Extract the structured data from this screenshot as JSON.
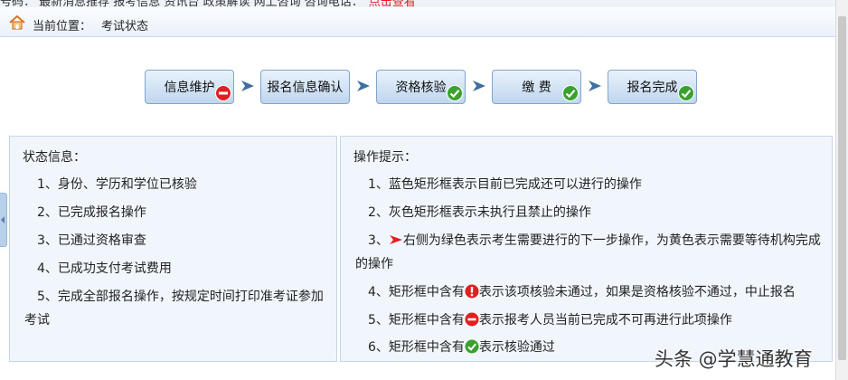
{
  "top_strip": {
    "cut_text": "号码：  最新消息推荐  报考信息  资讯台  政策解读  网上咨询  咨询电话：",
    "cut_red": "点击查看"
  },
  "breadcrumb": {
    "label": "当前位置：",
    "value": "考试状态"
  },
  "steps": [
    {
      "label": "信息维护",
      "status": "blocked",
      "icon": "minus-circle-icon"
    },
    {
      "label": "报名信息确认",
      "status": "none",
      "icon": ""
    },
    {
      "label": "资格核验",
      "status": "passed",
      "icon": "check-circle-icon"
    },
    {
      "label": "缴 费",
      "status": "passed",
      "icon": "check-circle-icon"
    },
    {
      "label": "报名完成",
      "status": "passed",
      "icon": "check-circle-icon"
    }
  ],
  "status_panel": {
    "title": "状态信息：",
    "items": [
      "1、身份、学历和学位已核验",
      "2、已完成报名操作",
      "3、已通过资格审查",
      "4、已成功支付考试费用",
      "5、完成全部报名操作，按规定时间打印准考证参加",
      "考试"
    ]
  },
  "hints_panel": {
    "title": "操作提示：",
    "item1": "1、蓝色矩形框表示目前已完成还可以进行的操作",
    "item2": "2、灰色矩形框表示未执行且禁止的操作",
    "item3_prefix": "3、",
    "item3_text": "右侧为绿色表示考生需要进行的下一步操作，为黄色表示需要等待机构完成",
    "item3_cont": "的操作",
    "item4_prefix": "4、矩形框中含有",
    "item4_text": "表示该项核验未通过，如果是资格核验不通过，中止报名",
    "item5_prefix": "5、矩形框中含有",
    "item5_text": "表示报考人员当前已完成不可再进行此项操作",
    "item6_prefix": "6、矩形框中含有",
    "item6_text": "表示核验通过"
  },
  "watermark": "头条 @学慧通教育",
  "colors": {
    "step_border": "#7fa6cc",
    "arrow": "#3d6f9f",
    "red_badge": "#e02020",
    "green_badge": "#3aa12f",
    "panel_bg": "#f0f6fc"
  }
}
